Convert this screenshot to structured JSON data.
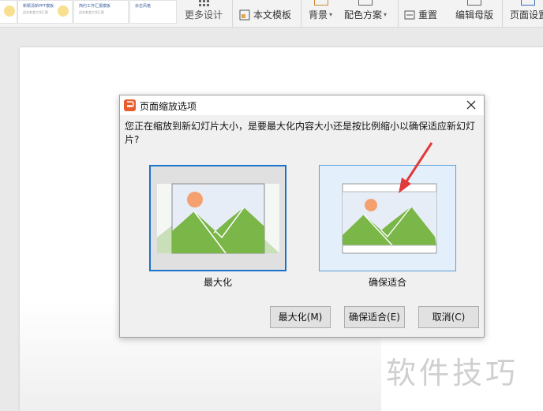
{
  "ribbon": {
    "thumbs": [
      {
        "title": "",
        "sub": ""
      },
      {
        "title": "新颖清新PPT模板",
        "sub": "适合各类工作汇报"
      },
      {
        "title": "简约工作汇报模板",
        "sub": "适合各类工作汇报"
      },
      {
        "title": "杂志风格",
        "sub": ""
      }
    ],
    "more_design": "更多设计",
    "text_template": "本文模板",
    "background": "背景",
    "color_scheme": "配色方案",
    "reset": "重置",
    "edit_master": "编辑母版",
    "page_setup": "页面设置"
  },
  "dialog": {
    "title": "页面缩放选项",
    "message": "您正在缩放到新幻灯片大小，是要最大化内容大小还是按比例缩小以确保适应新幻灯片?",
    "options": [
      {
        "label": "最大化"
      },
      {
        "label": "确保适合"
      }
    ],
    "buttons": {
      "maximize": "最大化(M)",
      "ensure_fit": "确保适合(E)",
      "cancel": "取消(C)"
    }
  },
  "watermark": "软件技巧",
  "colors": {
    "accent": "#1b72c9",
    "sun": "#f4a06f",
    "mountain": "#7ab648",
    "app_icon": "#e85d2a",
    "arrow": "#e03a3a"
  }
}
